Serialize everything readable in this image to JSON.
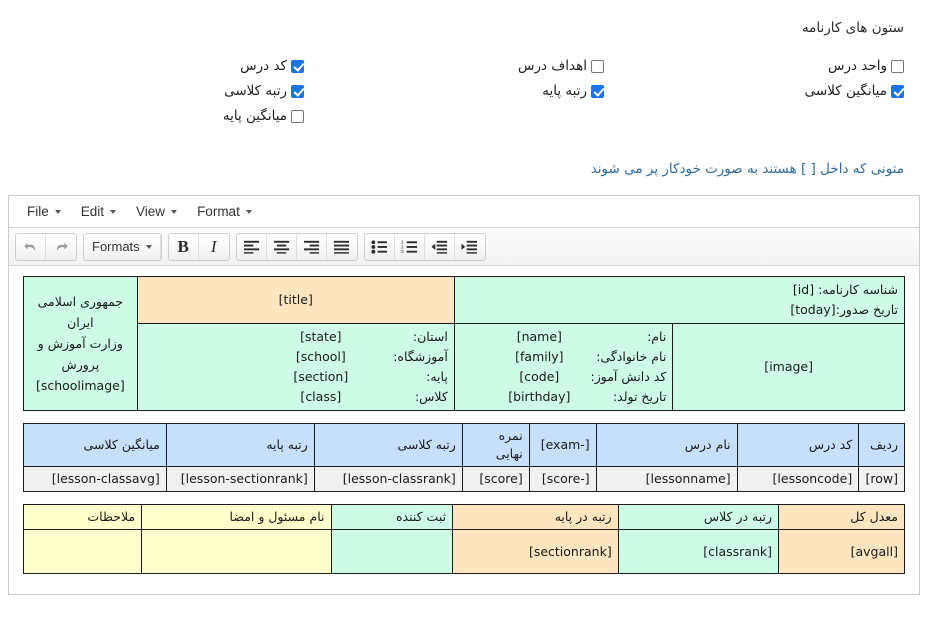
{
  "columns_chooser": {
    "title": "ستون های کارنامه",
    "groups": [
      {
        "name": "group-right",
        "items": [
          {
            "label": "کد درس",
            "checked": true
          },
          {
            "label": "رتبه کلاسی",
            "checked": true
          },
          {
            "label": "میانگین پایه",
            "checked": false
          }
        ]
      },
      {
        "name": "group-middle",
        "items": [
          {
            "label": "اهداف درس",
            "checked": false
          },
          {
            "label": "رتبه پایه",
            "checked": true
          }
        ]
      },
      {
        "name": "group-left",
        "items": [
          {
            "label": "واحد درس",
            "checked": false
          },
          {
            "label": "میانگین کلاسی",
            "checked": true
          }
        ]
      }
    ]
  },
  "hint": {
    "text": "متونی که داخل [ ] هستند به صورت خودکار پر می شوند",
    "color": "#2f6c9e"
  },
  "editor": {
    "menubar": [
      {
        "label": "File"
      },
      {
        "label": "Edit"
      },
      {
        "label": "View"
      },
      {
        "label": "Format"
      }
    ],
    "toolbar": {
      "undo_icon": "undo-arrow-icon",
      "redo_icon": "redo-arrow-icon",
      "formats_label": "Formats",
      "bold_label": "B",
      "italic_label": "I",
      "align_left_icon": "align-left-icon",
      "align_center_icon": "align-center-icon",
      "align_right_icon": "align-right-icon",
      "align_justify_icon": "align-justify-icon",
      "bullet_list_icon": "bullet-list-icon",
      "numbered_list_icon": "numbered-list-icon",
      "outdent_icon": "outdent-icon",
      "indent_icon": "indent-icon"
    }
  },
  "document": {
    "header_table": {
      "id_label": "شناسه کارنامه:",
      "id_value": "[id]",
      "issue_label": "تاریخ صدور:",
      "issue_value": "[today]",
      "title_value": "[title]",
      "nation_line1": "جمهوری اسلامی ایران",
      "nation_line2": "وزارت آموزش و پرورش",
      "nation_logo": "[schoolimage]",
      "image_placeholder": "[image]",
      "student_fields": [
        {
          "label": "نام:",
          "value": "[name]"
        },
        {
          "label": "نام خانوادگی:",
          "value": "[family]"
        },
        {
          "label": "کد دانش آموز:",
          "value": "[code]"
        },
        {
          "label": "تاریخ تولد:",
          "value": "[birthday]"
        }
      ],
      "school_fields": [
        {
          "label": "استان:",
          "value": "[state]"
        },
        {
          "label": "آموزشگاه:",
          "value": "[school]"
        },
        {
          "label": "پایه:",
          "value": "[section]"
        },
        {
          "label": "کلاس:",
          "value": "[class]"
        }
      ]
    },
    "grades_table": {
      "headers": [
        "ردیف",
        "کد درس",
        "نام درس",
        "[-exam]",
        "نمره نهایی",
        "رتبه کلاسی",
        "رتبه پایه",
        "میانگین کلاسی"
      ],
      "row": [
        "[row]",
        "[lessoncode]",
        "[lessonname]",
        "[-score]",
        "[score]",
        "[lesson-classrank]",
        "[lesson-sectionrank]",
        "[lesson-classavg]"
      ]
    },
    "summary_table": {
      "headers": [
        "معدل کل",
        "رتبه در کلاس",
        "رتبه در پایه",
        "ثبت کننده",
        "نام مسئول و امضا",
        "ملاحظات"
      ],
      "values": [
        "[avgall]",
        "[classrank]",
        "[sectionrank]",
        "",
        "",
        ""
      ]
    }
  },
  "palette": {
    "mint": "#cdfbe6",
    "orange": "#fce5bf",
    "blue": "#c6e0fb",
    "yellow": "#ffffcc",
    "gray": "#f0f0f0"
  }
}
